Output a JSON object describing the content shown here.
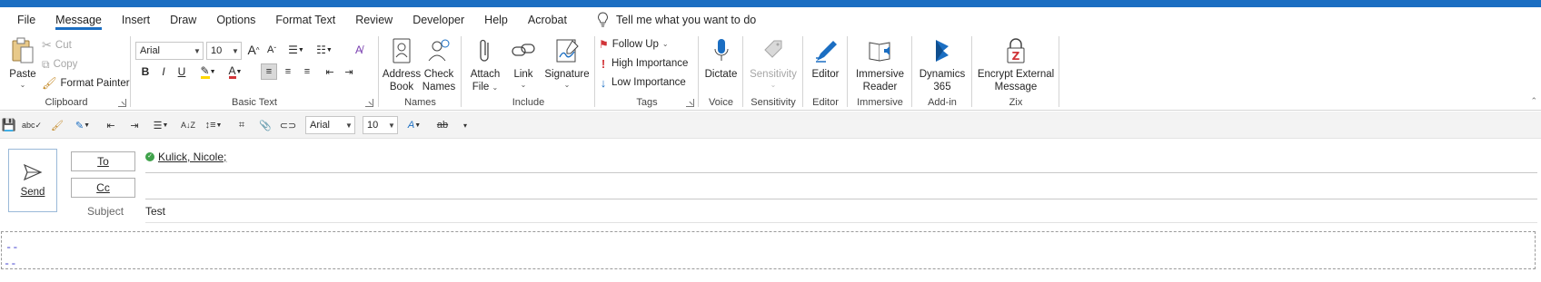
{
  "tabs": [
    "File",
    "Message",
    "Insert",
    "Draw",
    "Options",
    "Format Text",
    "Review",
    "Developer",
    "Help",
    "Acrobat"
  ],
  "active_tab": "Message",
  "tell_me": "Tell me what you want to do",
  "clipboard": {
    "paste": "Paste",
    "cut": "Cut",
    "copy": "Copy",
    "format_painter": "Format Painter",
    "label": "Clipboard"
  },
  "basic_text": {
    "font": "Arial",
    "size": "10",
    "grow": "A",
    "shrink": "A",
    "bold": "B",
    "italic": "I",
    "underline": "U",
    "font_color_letter": "A",
    "label": "Basic Text"
  },
  "names": {
    "address_book_1": "Address",
    "address_book_2": "Book",
    "check_names_1": "Check",
    "check_names_2": "Names",
    "label": "Names"
  },
  "include": {
    "attach_file_1": "Attach",
    "attach_file_2": "File",
    "link": "Link",
    "signature": "Signature",
    "label": "Include"
  },
  "tags": {
    "follow_up": "Follow Up",
    "high_importance": "High Importance",
    "low_importance": "Low Importance",
    "label": "Tags"
  },
  "voice": {
    "dictate": "Dictate",
    "label": "Voice"
  },
  "sensitivity": {
    "button": "Sensitivity",
    "label": "Sensitivity"
  },
  "editor": {
    "button": "Editor",
    "label": "Editor"
  },
  "immersive": {
    "button_1": "Immersive",
    "button_2": "Reader",
    "label": "Immersive"
  },
  "addin": {
    "button_1": "Dynamics",
    "button_2": "365",
    "label": "Add-in"
  },
  "zix": {
    "button_1": "Encrypt External",
    "button_2": "Message",
    "label": "Zix"
  },
  "qat": {
    "font": "Arial",
    "size": "10"
  },
  "compose": {
    "send": "Send",
    "to_label": "To",
    "cc_label": "Cc",
    "subject_label": "Subject",
    "to_value": "Kulick, Nicole;",
    "subject_value": "Test",
    "signature_line_1": "--",
    "signature_line_2": "--"
  },
  "colors": {
    "accent": "#1b6ec2",
    "high_importance": "#d13438",
    "low_importance": "#1b6ec2",
    "font_color": "#d13438",
    "highlight": "#ffd700",
    "zix": "#d13438"
  }
}
